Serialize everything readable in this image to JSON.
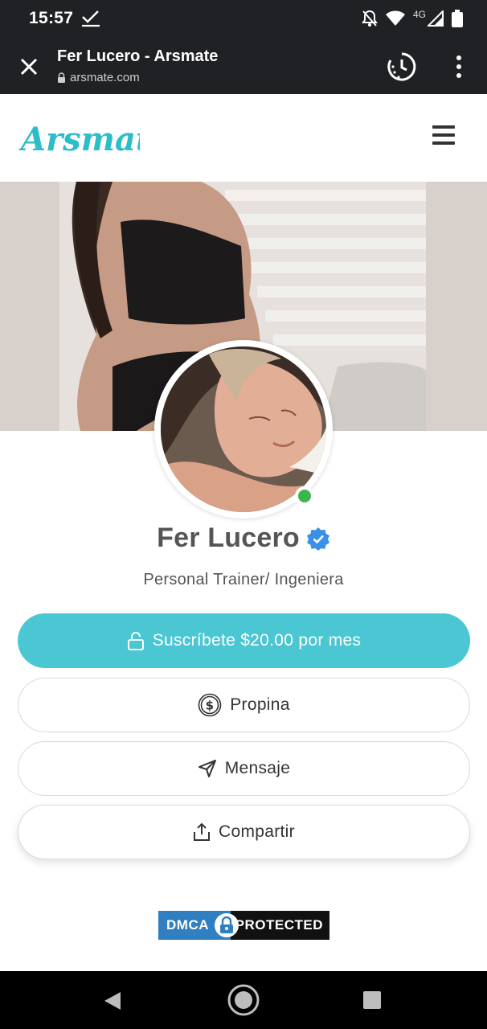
{
  "status_bar": {
    "time": "15:57",
    "network": "4G",
    "icons": [
      "check-icon",
      "mute-icon",
      "wifi-icon",
      "signal-icon",
      "battery-icon"
    ]
  },
  "browser": {
    "title": "Fer Lucero - Arsmate",
    "url": "arsmate.com",
    "icons": [
      "close-icon",
      "lock-icon",
      "history-icon",
      "more-vert-icon"
    ]
  },
  "site": {
    "logo_text": "Arsmate",
    "logo_color": "#2bbdc9",
    "menu_icon": "hamburger-icon"
  },
  "profile": {
    "name": "Fer Lucero",
    "bio": "Personal Trainer/ Ingeniera",
    "verified_icon": "verified-badge-icon",
    "online": true,
    "online_color": "#3cb54a"
  },
  "actions": {
    "subscribe_label": "Suscríbete $20.00 por mes",
    "subscribe_color": "#4ac7d2",
    "tip_label": "Propina",
    "message_label": "Mensaje",
    "share_label": "Compartir"
  },
  "dmca": {
    "left_text": "DMCA",
    "right_text": "PROTECTED"
  },
  "nav": {
    "icons": [
      "back-icon",
      "home-icon",
      "recents-icon"
    ]
  }
}
